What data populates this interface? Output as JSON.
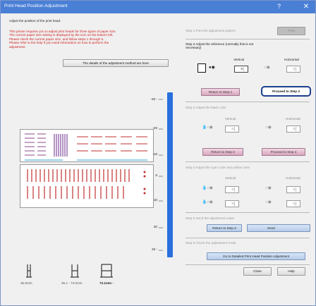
{
  "window": {
    "title": "Print Head Position Adjustment",
    "help_glyph": "?",
    "close_glyph": "✕"
  },
  "left": {
    "heading": "Adjust the position of the print head.",
    "intro_lines": [
      "This printer requires you to adjust print heads for three types of paper size.",
      "The current paper size setting is displayed by the icon on the bottom left.",
      "Please check the current paper size, and follow steps 1 through 5.",
      "Please refer to the help if you need information on how to perform the",
      "adjustment."
    ],
    "details_button": "The details of the adjustment method are here",
    "scale_labels": [
      "-32 -",
      "-20",
      "-10",
      "0",
      "10",
      "20",
      "32 -"
    ],
    "sizes": [
      {
        "label": "35.6mm",
        "icon": "paper-size-small-icon"
      },
      {
        "label": "35.1 - 73.0mm",
        "icon": "paper-size-medium-icon"
      },
      {
        "label": "73.1mm -",
        "icon": "paper-size-large-icon"
      }
    ]
  },
  "steps": {
    "s1": {
      "label": "Step 1  Print the adjustment pattern",
      "button": "Print"
    },
    "s2": {
      "label_lines": [
        "Step 2  Adjust the reference (normally this is not",
        "necessary)"
      ],
      "vertical": "Vertical",
      "horizontal": "Horizontal",
      "vertical_value": "0",
      "horizontal_value": "0",
      "return_button": "Return to Step 1",
      "proceed_button": "Proceed to Step 3"
    },
    "s3": {
      "label": "Step 3  Adjust the black color",
      "vertical": "Vertical",
      "horizontal": "Horizontal",
      "vertical_value": "0",
      "horizontal_value": "0",
      "return_button": "Return to Step 2",
      "proceed_button": "Proceed to Step 4"
    },
    "s4": {
      "label": "Step 4  Adjust the cyan color and yellow color",
      "vertical": "Vertical",
      "horizontal": "Horizontal",
      "cyan_vertical": "0",
      "cyan_horizontal": "0",
      "yellow_vertical": "0",
      "yellow_horizontal": "0"
    },
    "s5": {
      "label": "Step 5  Send the adjustment value",
      "return_button": "Return to Step 3",
      "send_button": "Send"
    },
    "s6": {
      "label": "Step 6  Check the adjustment result",
      "goto_button": "Go to Detailed Print Head Position Adjustment"
    }
  },
  "footer": {
    "close_button": "Close",
    "help_button": "Help"
  },
  "colors": {
    "titlebar": "#4a7fd6",
    "slider": "#2a6fdf",
    "highlight": "#1c3f8f",
    "pink_button": "#e5bcd0",
    "black_drop": "#111111",
    "cyan_drop": "#2a9fd6",
    "yellow_drop": "#e0b000"
  }
}
